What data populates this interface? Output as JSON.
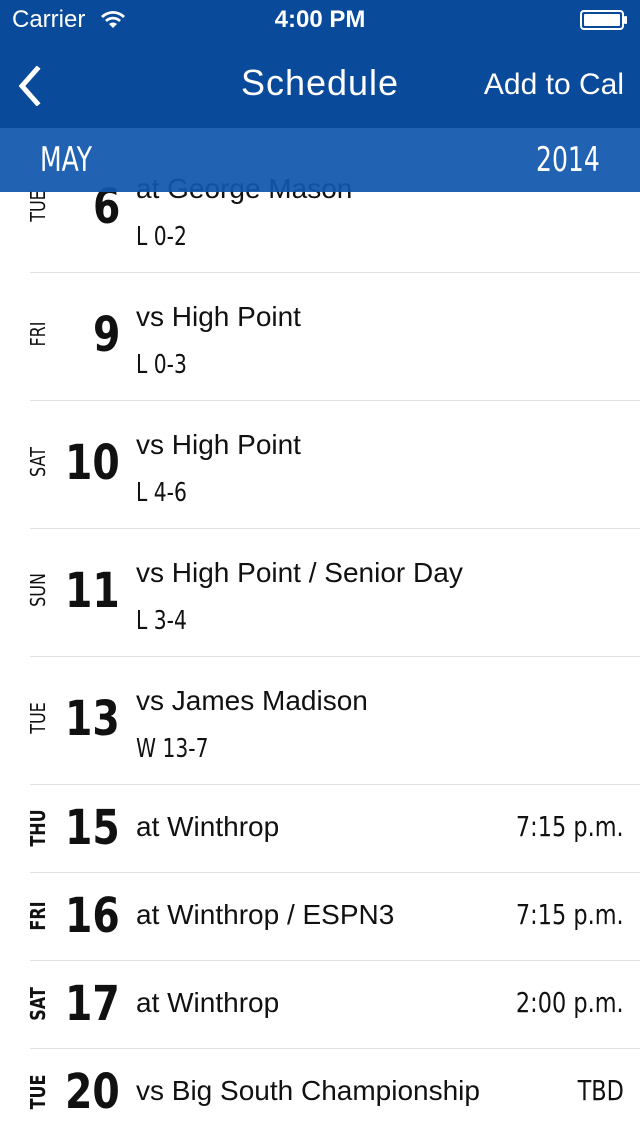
{
  "status_bar": {
    "carrier": "Carrier",
    "time": "4:00 PM",
    "wifi_icon": "wifi-icon",
    "battery_icon": "battery-icon"
  },
  "nav": {
    "back_icon": "chevron-left-icon",
    "title": "Schedule",
    "add_to_cal": "Add to Cal"
  },
  "month_header": {
    "month": "MAY",
    "year": "2014"
  },
  "colors": {
    "nav_background": "#0a4a9a",
    "month_header_background": "#1056ac",
    "text": "#111111",
    "divider": "#e0e0e0"
  },
  "games": [
    {
      "dow": "TUE",
      "day": "6",
      "opponent": "at George Mason",
      "result": "L 0-2",
      "time": ""
    },
    {
      "dow": "FRI",
      "day": "9",
      "opponent": "vs High Point",
      "result": "L 0-3",
      "time": ""
    },
    {
      "dow": "SAT",
      "day": "10",
      "opponent": "vs High Point",
      "result": "L 4-6",
      "time": ""
    },
    {
      "dow": "SUN",
      "day": "11",
      "opponent": "vs High Point / Senior Day",
      "result": "L 3-4",
      "time": ""
    },
    {
      "dow": "TUE",
      "day": "13",
      "opponent": "vs James Madison",
      "result": "W 13-7",
      "time": ""
    },
    {
      "dow": "THU",
      "day": "15",
      "opponent": "at Winthrop",
      "result": "",
      "time": "7:15 p.m."
    },
    {
      "dow": "FRI",
      "day": "16",
      "opponent": "at Winthrop / ESPN3",
      "result": "",
      "time": "7:15 p.m."
    },
    {
      "dow": "SAT",
      "day": "17",
      "opponent": "at Winthrop",
      "result": "",
      "time": "2:00 p.m."
    },
    {
      "dow": "TUE",
      "day": "20",
      "opponent": "vs Big South Championship",
      "result": "",
      "time": "TBD"
    }
  ]
}
